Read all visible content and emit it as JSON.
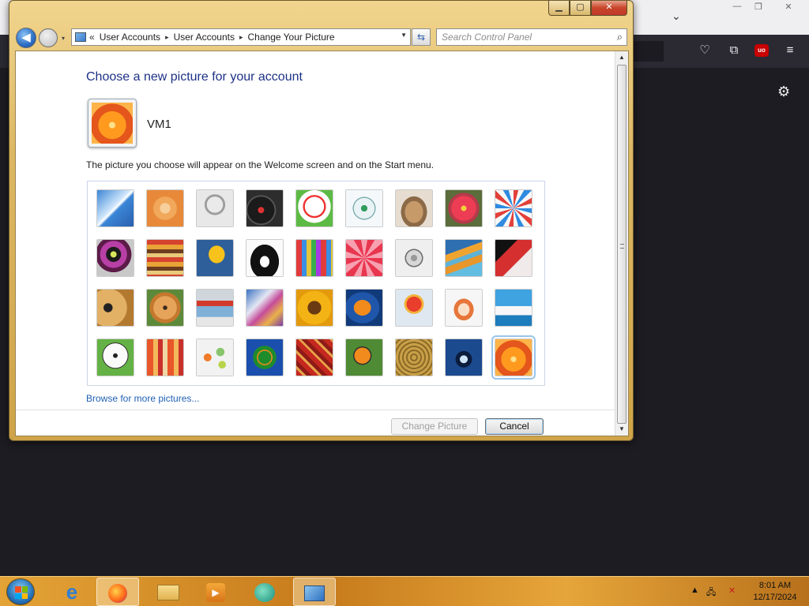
{
  "window": {
    "minimize_icon": "minimize-icon",
    "maximize_icon": "maximize-icon",
    "close_icon": "close-icon",
    "breadcrumb_chevron": "«",
    "breadcrumb": [
      "User Accounts",
      "User Accounts",
      "Change Your Picture"
    ],
    "breadcrumb_sep": "▸",
    "search_placeholder": "Search Control Panel"
  },
  "main": {
    "heading": "Choose a new picture for your account",
    "username": "VM1",
    "description": "The picture you choose will appear on the Welcome screen and on the Start menu.",
    "browse_link": "Browse for more pictures...",
    "change_button": "Change Picture",
    "cancel_button": "Cancel",
    "selected_picture": "orange-flower",
    "pictures": [
      [
        "roller-coaster",
        "starfish",
        "robot-figure",
        "turntable",
        "lucky-cat",
        "gyroscope",
        "kitten",
        "pink-flower",
        "ferris-wheel"
      ],
      [
        "ball",
        "fabric-stack",
        "yellow-leaf",
        "border-collie",
        "crayons",
        "pink-star",
        "jacks",
        "stairs",
        "paper-crane"
      ],
      [
        "guitar",
        "pomeranian",
        "tin-robot",
        "cloth",
        "sunflower",
        "fish",
        "hot-air-balloon",
        "egg-doll",
        "sailboat"
      ],
      [
        "soccer-ball",
        "textile",
        "marbles",
        "green-window",
        "woven-fabric",
        "butterfly",
        "golden-spiral",
        "lantern",
        "orange-flower"
      ]
    ]
  },
  "firefox": {
    "chevron": "⌄",
    "gear": "⚙",
    "ublock_label": "uo",
    "icons": [
      "pocket-icon",
      "extensions-icon",
      "ublock-icon",
      "menu-icon",
      "settings-icon"
    ]
  },
  "taskbar": {
    "apps": [
      "start-button",
      "internet-explorer",
      "firefox",
      "explorer",
      "media-player",
      "chat",
      "control-panel"
    ],
    "time": "8:01 AM",
    "date": "12/17/2024"
  },
  "colors": {
    "heading": "#1e3287",
    "link": "#1f5fb5",
    "window_frame": "#dcb763",
    "taskbar": "#d98f2a"
  }
}
